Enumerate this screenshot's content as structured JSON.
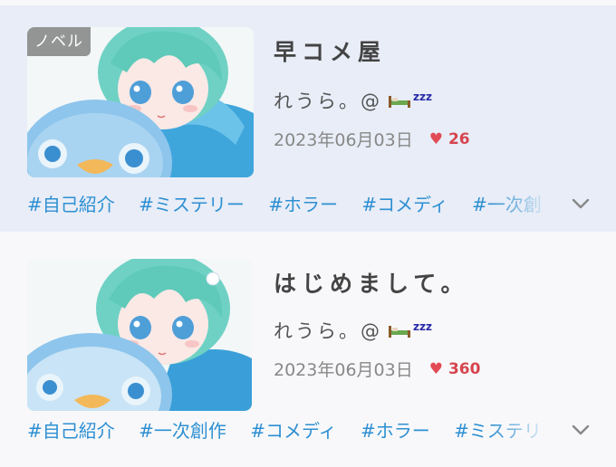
{
  "works": [
    {
      "badge": "ノベル",
      "title": "早コメ屋",
      "author": "れうら。@",
      "zzz": "zzz",
      "date": "2023年06月03日",
      "likes": "26",
      "tags": [
        "#自己紹介",
        "#ミステリー",
        "#ホラー",
        "#コメディ",
        "#一次創"
      ]
    },
    {
      "title": "はじめまして。",
      "author": "れうら。@",
      "zzz": "zzz",
      "date": "2023年06月03日",
      "likes": "360",
      "tags": [
        "#自己紹介",
        "#一次創作",
        "#コメディ",
        "#ホラー",
        "#ミステリ"
      ]
    }
  ],
  "icons": {
    "heart": "heart-icon",
    "bed": "bed-icon",
    "expand": "chevron-down-icon"
  },
  "colors": {
    "accent_tag": "#2d8fd2",
    "like": "#d6454f",
    "selected_bg": "#e8edf7"
  }
}
